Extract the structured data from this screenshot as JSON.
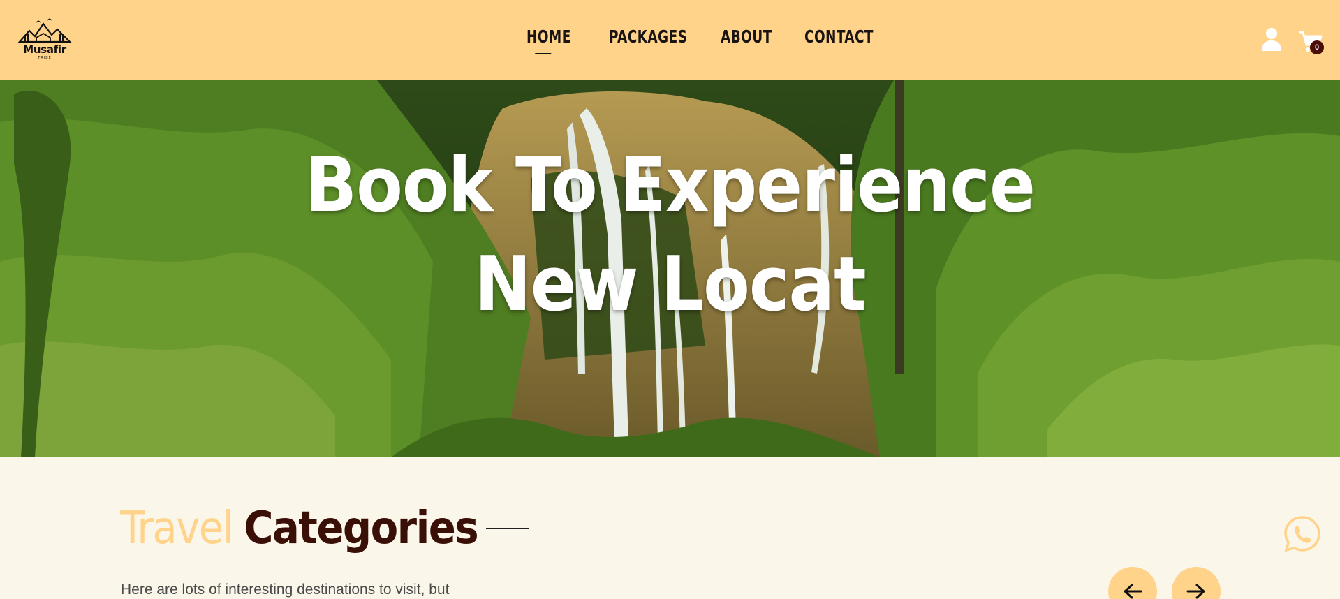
{
  "header": {
    "logo": {
      "brand": "Musafir",
      "tagline": "TRIBE"
    },
    "nav": [
      {
        "label": "HOME",
        "active": true
      },
      {
        "label": "PACKAGES",
        "active": false
      },
      {
        "label": "ABOUT",
        "active": false
      },
      {
        "label": "CONTACT",
        "active": false
      }
    ],
    "user_icon": "user-icon",
    "cart_icon": "cart-icon",
    "cart_count": "0"
  },
  "hero": {
    "title_line1": "Book To Experience",
    "title_line2": "New Locat"
  },
  "categories": {
    "title_accent": "Travel",
    "title_main": "Categories",
    "description": "Here are lots of interesting destinations to visit, but",
    "prev_icon": "arrow-left-icon",
    "next_icon": "arrow-right-icon"
  },
  "floating": {
    "whatsapp_icon": "whatsapp-icon"
  },
  "colors": {
    "header_bg": "#ffd389",
    "page_bg": "#fbf6ea",
    "accent": "#ffd389",
    "heading_dark": "#3a0f06",
    "badge": "#4a0f08"
  }
}
